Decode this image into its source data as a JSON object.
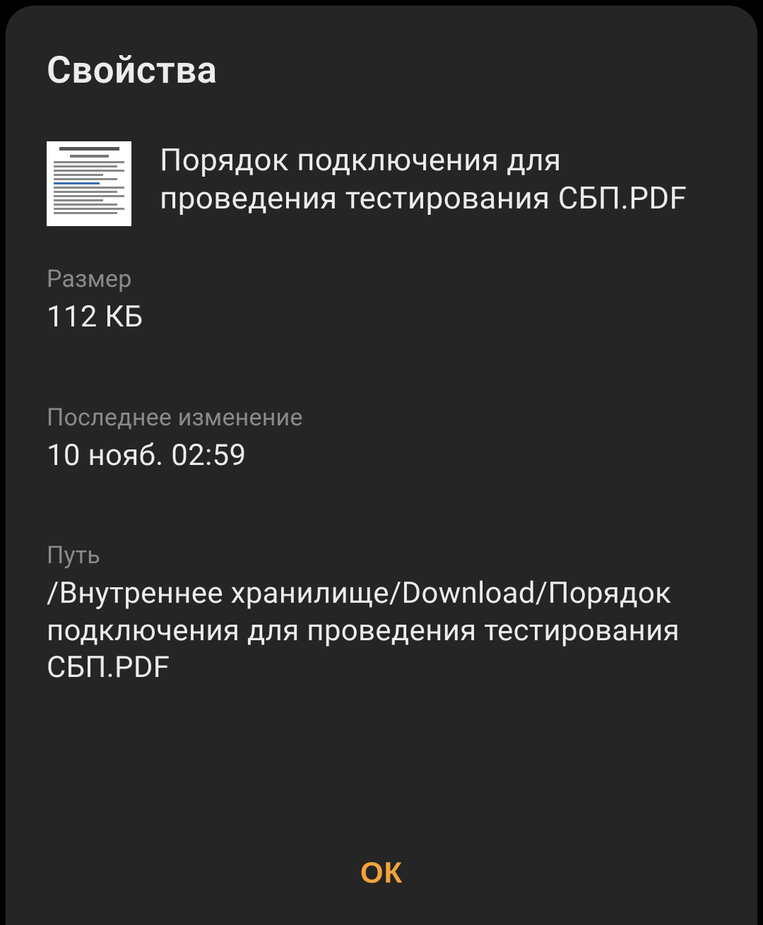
{
  "dialog": {
    "title": "Свойства",
    "file_name": "Порядок подключения для проведения тестирования СБП.PDF",
    "size": {
      "label": "Размер",
      "value": "112 КБ"
    },
    "modified": {
      "label": "Последнее изменение",
      "value": "10 нояб. 02:59"
    },
    "path": {
      "label": "Путь",
      "value": "/Внутреннее хранилище/Download/Порядок подключения для проведения тестирования СБП.PDF"
    },
    "ok_button": "ОК"
  }
}
